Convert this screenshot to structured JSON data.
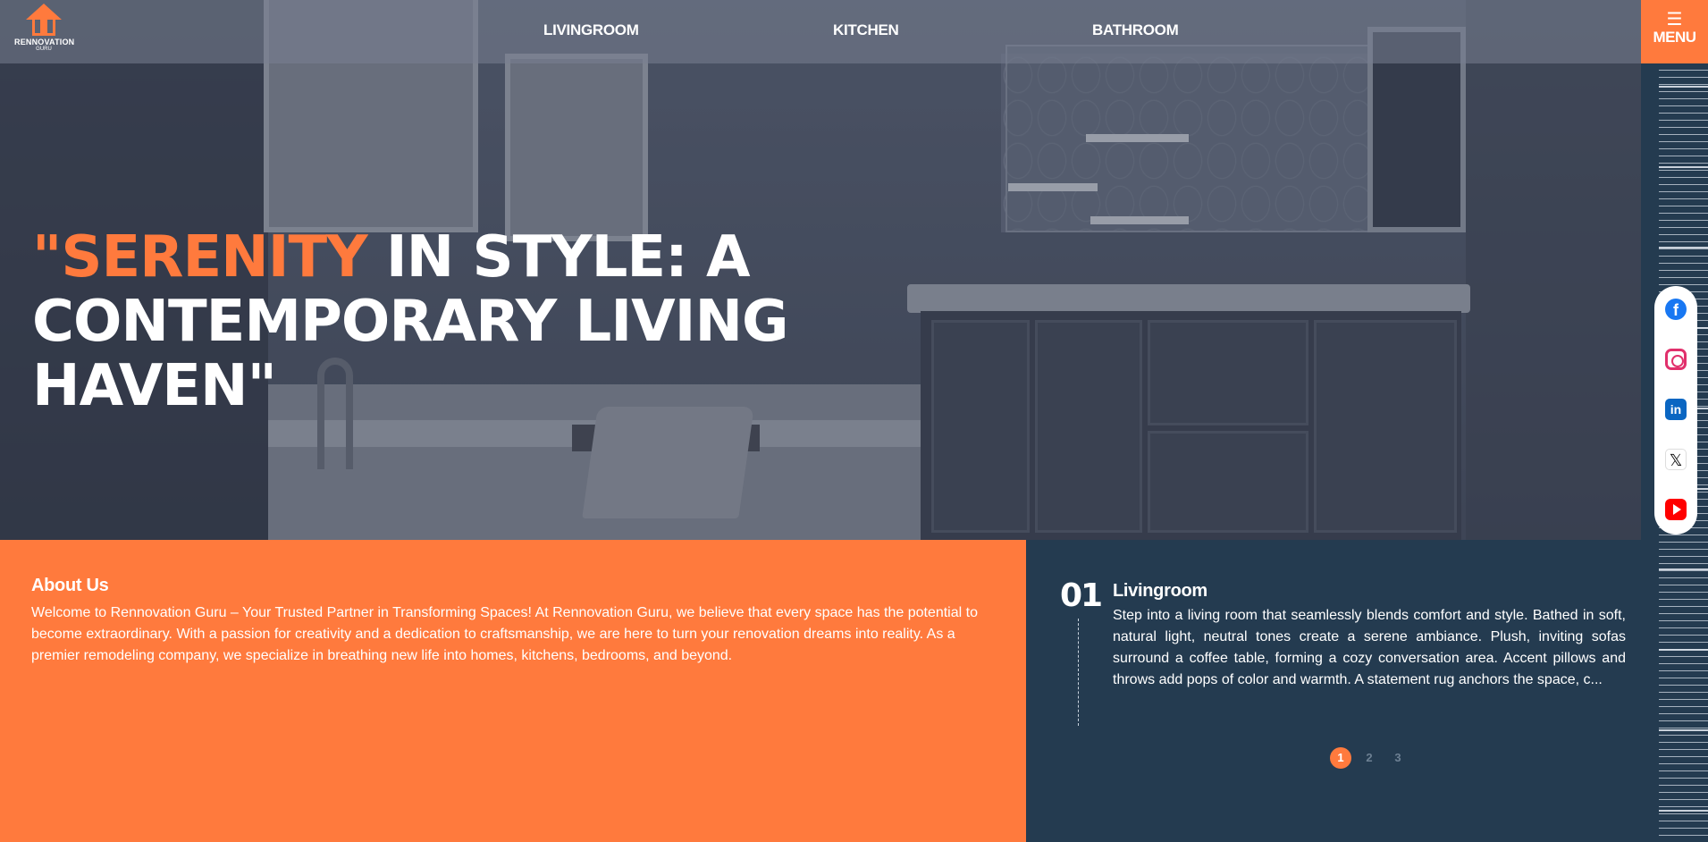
{
  "brand": {
    "name": "RENNOVATION",
    "sub": "GURU"
  },
  "nav": {
    "items": [
      "LIVINGROOM",
      "KITCHEN",
      "BATHROOM"
    ]
  },
  "menu": {
    "label": "MENU",
    "icon": "hamburger-icon"
  },
  "hero": {
    "headline_accent": "\"SERENITY",
    "headline_rest": " IN STYLE: A CONTEMPORARY LIVING HAVEN\""
  },
  "social": [
    "facebook-icon",
    "instagram-icon",
    "linkedin-icon",
    "x-icon",
    "youtube-icon"
  ],
  "about": {
    "title": "About Us",
    "text": "Welcome to Rennovation Guru – Your Trusted Partner in Transforming Spaces! At Rennovation Guru, we believe that every space has the potential to become extraordinary. With a passion for creativity and a dedication to craftsmanship, we are here to turn your renovation dreams into reality. As a premier remodeling company, we specialize in breathing new life into homes, kitchens, bedrooms, and beyond."
  },
  "slider": {
    "number": "01",
    "title": "Livingroom",
    "text": "Step into a living room that seamlessly blends comfort and style. Bathed in soft, natural light, neutral tones create a serene ambiance. Plush, inviting sofas surround a coffee table, forming a cozy conversation area. Accent pillows and throws add pops of color and warmth. A statement rug anchors the space, c...",
    "pages": [
      "1",
      "2",
      "3"
    ],
    "active_page": "1"
  },
  "colors": {
    "accent": "#ff7a3d",
    "navy": "#243b50"
  }
}
